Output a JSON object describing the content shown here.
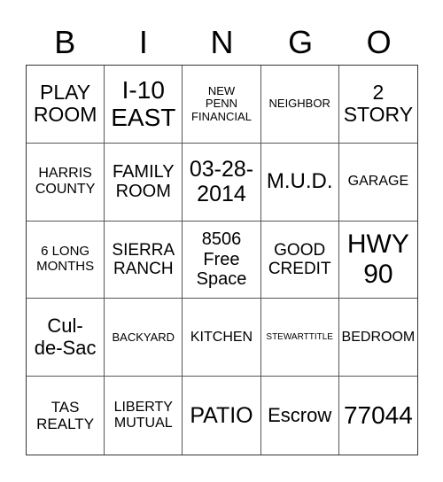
{
  "header": [
    "B",
    "I",
    "N",
    "G",
    "O"
  ],
  "cells": [
    "PLAY\nROOM",
    "I-10\nEAST",
    "NEW\nPENN\nFINANCIAL",
    "NEIGHBOR",
    "2\nSTORY",
    "HARRIS\nCOUNTY",
    "FAMILY\nROOM",
    "03-28-\n2014",
    "M.U.D.",
    "GARAGE",
    "6 LONG\nMONTHS",
    "SIERRA\nRANCH",
    "8506\nFree\nSpace",
    "GOOD\nCREDIT",
    "HWY\n90",
    "Cul-\nde-Sac",
    "BACKYARD",
    "KITCHEN",
    "STEWARTTITLE",
    "BEDROOM",
    "TAS\nREALTY",
    "LIBERTY\nMUTUAL",
    "PATIO",
    "Escrow",
    "77044"
  ]
}
